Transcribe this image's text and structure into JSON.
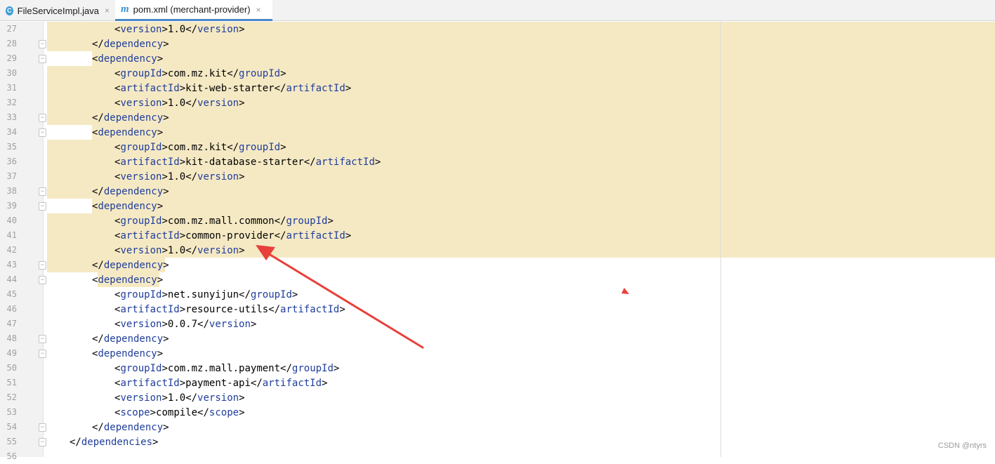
{
  "tabs": [
    {
      "label": "FileServiceImpl.java",
      "icon": "java-class-icon",
      "icon_glyph": "C",
      "active": false
    },
    {
      "label": "pom.xml (merchant-provider)",
      "icon": "maven-icon",
      "icon_glyph": "m",
      "active": true
    }
  ],
  "close_glyph": "×",
  "colors": {
    "highlight": "#f5e9c4",
    "tag": "#1f3d9c",
    "annotation_arrow": "#e8403a",
    "gutter": "#f2f2f2"
  },
  "editor": {
    "lines": [
      {
        "n": "27",
        "indent": 3,
        "tag": "version",
        "value": "1.0",
        "open_only": false,
        "close_only": false,
        "highlight": "full",
        "fold": ""
      },
      {
        "n": "28",
        "indent": 2,
        "tag": "dependency",
        "close_only": true,
        "highlight": "full",
        "fold": "end"
      },
      {
        "n": "29",
        "indent": 2,
        "tag": "dependency",
        "open_only": true,
        "highlight": "partial",
        "fold": "start"
      },
      {
        "n": "30",
        "indent": 3,
        "tag": "groupId",
        "value": "com.mz.kit",
        "highlight": "full",
        "fold": ""
      },
      {
        "n": "31",
        "indent": 3,
        "tag": "artifactId",
        "value": "kit-web-starter",
        "highlight": "full",
        "fold": ""
      },
      {
        "n": "32",
        "indent": 3,
        "tag": "version",
        "value": "1.0",
        "highlight": "full",
        "fold": ""
      },
      {
        "n": "33",
        "indent": 2,
        "tag": "dependency",
        "close_only": true,
        "highlight": "full",
        "fold": "end"
      },
      {
        "n": "34",
        "indent": 2,
        "tag": "dependency",
        "open_only": true,
        "highlight": "partial",
        "fold": "start"
      },
      {
        "n": "35",
        "indent": 3,
        "tag": "groupId",
        "value": "com.mz.kit",
        "highlight": "full",
        "fold": ""
      },
      {
        "n": "36",
        "indent": 3,
        "tag": "artifactId",
        "value": "kit-database-starter",
        "highlight": "full",
        "fold": ""
      },
      {
        "n": "37",
        "indent": 3,
        "tag": "version",
        "value": "1.0",
        "highlight": "full",
        "fold": ""
      },
      {
        "n": "38",
        "indent": 2,
        "tag": "dependency",
        "close_only": true,
        "highlight": "full",
        "fold": "end"
      },
      {
        "n": "39",
        "indent": 2,
        "tag": "dependency",
        "open_only": true,
        "highlight": "partial",
        "fold": "start"
      },
      {
        "n": "40",
        "indent": 3,
        "tag": "groupId",
        "value": "com.mz.mall.common",
        "highlight": "full",
        "fold": ""
      },
      {
        "n": "41",
        "indent": 3,
        "tag": "artifactId",
        "value": "common-provider",
        "highlight": "full",
        "fold": ""
      },
      {
        "n": "42",
        "indent": 3,
        "tag": "version",
        "value": "1.0",
        "highlight": "full",
        "fold": ""
      },
      {
        "n": "43",
        "indent": 2,
        "tag": "dependency",
        "close_only": true,
        "highlight": "tail",
        "fold": "end"
      },
      {
        "n": "44",
        "indent": 2,
        "tag": "dependency",
        "open_only": true,
        "highlight": "short",
        "fold": "start"
      },
      {
        "n": "45",
        "indent": 3,
        "tag": "groupId",
        "value": "net.sunyijun",
        "highlight": "none",
        "fold": ""
      },
      {
        "n": "46",
        "indent": 3,
        "tag": "artifactId",
        "value": "resource-utils",
        "highlight": "none",
        "fold": ""
      },
      {
        "n": "47",
        "indent": 3,
        "tag": "version",
        "value": "0.0.7",
        "highlight": "none",
        "fold": ""
      },
      {
        "n": "48",
        "indent": 2,
        "tag": "dependency",
        "close_only": true,
        "highlight": "none",
        "fold": "end"
      },
      {
        "n": "49",
        "indent": 2,
        "tag": "dependency",
        "open_only": true,
        "highlight": "none",
        "fold": "start"
      },
      {
        "n": "50",
        "indent": 3,
        "tag": "groupId",
        "value": "com.mz.mall.payment",
        "highlight": "none",
        "fold": ""
      },
      {
        "n": "51",
        "indent": 3,
        "tag": "artifactId",
        "value": "payment-api",
        "highlight": "none",
        "fold": ""
      },
      {
        "n": "52",
        "indent": 3,
        "tag": "version",
        "value": "1.0",
        "highlight": "none",
        "fold": ""
      },
      {
        "n": "53",
        "indent": 3,
        "tag": "scope",
        "value": "compile",
        "highlight": "none",
        "fold": ""
      },
      {
        "n": "54",
        "indent": 2,
        "tag": "dependency",
        "close_only": true,
        "highlight": "none",
        "fold": "end"
      },
      {
        "n": "55",
        "indent": 1,
        "tag": "dependencies",
        "close_only": true,
        "highlight": "none",
        "fold": "end"
      },
      {
        "n": "56",
        "indent": 0,
        "tag": "",
        "highlight": "none",
        "fold": ""
      }
    ]
  },
  "watermark": "CSDN @ntyrs"
}
